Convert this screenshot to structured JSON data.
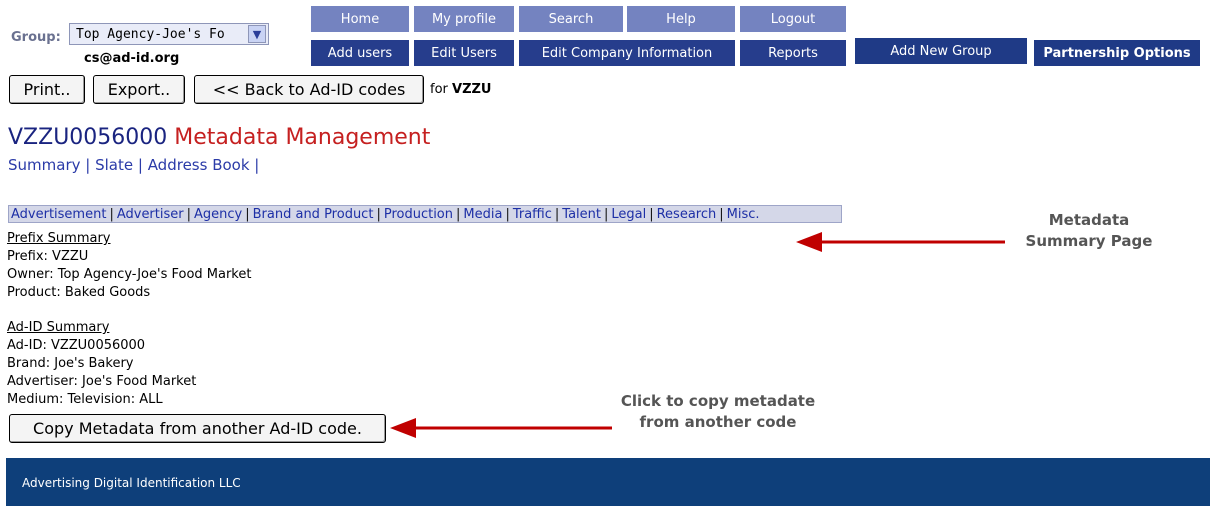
{
  "header": {
    "group_label": "Group:",
    "group_value": "Top Agency-Joe's Fo",
    "email": "cs@ad-id.org"
  },
  "nav_top": [
    "Home",
    "My profile",
    "Search",
    "Help",
    "Logout"
  ],
  "nav_bottom": [
    "Add users",
    "Edit Users",
    "Edit Company Information",
    "Reports"
  ],
  "nav_special": [
    "Add New Group",
    "Partnership Options"
  ],
  "toolbar": {
    "print": "Print..",
    "export": "Export..",
    "back": "<< Back to Ad-ID codes",
    "for_text": "for",
    "for_code": "VZZU"
  },
  "page": {
    "code": "VZZU0056000",
    "title_suffix": "Metadata Management",
    "links": [
      "Summary",
      "Slate",
      "Address Book"
    ]
  },
  "tabs": [
    "Advertisement",
    "Advertiser",
    "Agency",
    "Brand and Product",
    "Production",
    "Media",
    "Traffic",
    "Talent",
    "Legal",
    "Research",
    "Misc."
  ],
  "prefix_summary": {
    "header": "Prefix Summary",
    "lines": [
      "Prefix: VZZU",
      "Owner: Top Agency-Joe's Food Market",
      "Product: Baked Goods"
    ]
  },
  "adid_summary": {
    "header": "Ad-ID Summary",
    "lines": [
      "Ad-ID: VZZU0056000",
      "Brand: Joe's Bakery",
      "Advertiser: Joe's Food Market",
      "Medium: Television: ALL"
    ]
  },
  "copy_button": "Copy Metadata from another Ad-ID code.",
  "annotations": {
    "summary_note": [
      "Metadata",
      "Summary Page"
    ],
    "copy_note": [
      "Click to copy metadate",
      "from another code"
    ]
  },
  "footer": {
    "text": "Advertising Digital Identification LLC"
  },
  "colors": {
    "nav_light": "#7483c0",
    "nav_dark": "#263d8c",
    "footer": "#0e3f7a",
    "arrow": "#c00000",
    "title_red": "#c52020"
  }
}
